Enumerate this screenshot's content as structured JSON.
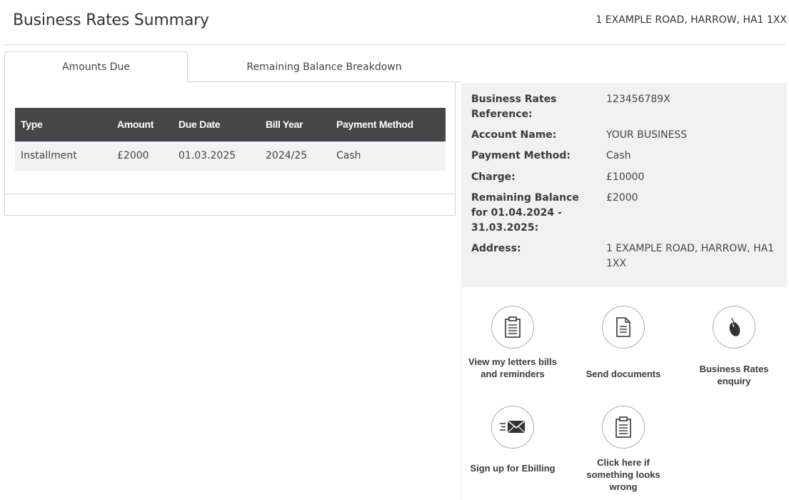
{
  "header": {
    "title": "Business Rates Summary",
    "address": "1 EXAMPLE ROAD, HARROW, HA1 1XX"
  },
  "tabs": [
    {
      "label": "Amounts Due",
      "active": true
    },
    {
      "label": "Remaining Balance Breakdown",
      "active": false
    }
  ],
  "table": {
    "columns": [
      "Type",
      "Amount",
      "Due Date",
      "Bill Year",
      "Payment Method"
    ],
    "rows": [
      [
        "Installment",
        "£2000",
        "01.03.2025",
        "2024/25",
        "Cash"
      ]
    ]
  },
  "info": {
    "reference_label": "Business Rates Reference:",
    "reference_value": "123456789X",
    "account_name_label": "Account Name:",
    "account_name_value": "YOUR BUSINESS",
    "payment_method_label": "Payment Method:",
    "payment_method_value": "Cash",
    "charge_label": "Charge:",
    "charge_value": "£10000",
    "remaining_label": "Remaining Balance for 01.04.2024 - 31.03.2025:",
    "remaining_value": "£2000",
    "address_label": "Address:",
    "address_value": "1 EXAMPLE ROAD, HARROW, HA1 1XX"
  },
  "actions": [
    {
      "label": "View my letters bills and reminders",
      "icon": "clipboard-icon"
    },
    {
      "label": "Send documents",
      "icon": "document-icon"
    },
    {
      "label": "Business Rates enquiry",
      "icon": "mouse-icon"
    },
    {
      "label": "Sign up for Ebilling",
      "icon": "envelope-icon"
    },
    {
      "label": "Click here if something looks wrong",
      "icon": "clipboard-icon"
    }
  ],
  "colors": {
    "table_header_bg": "#464646",
    "info_panel_bg": "#f1f1f1",
    "icon_stroke": "#333333",
    "circle_border": "#3b5a8a"
  }
}
